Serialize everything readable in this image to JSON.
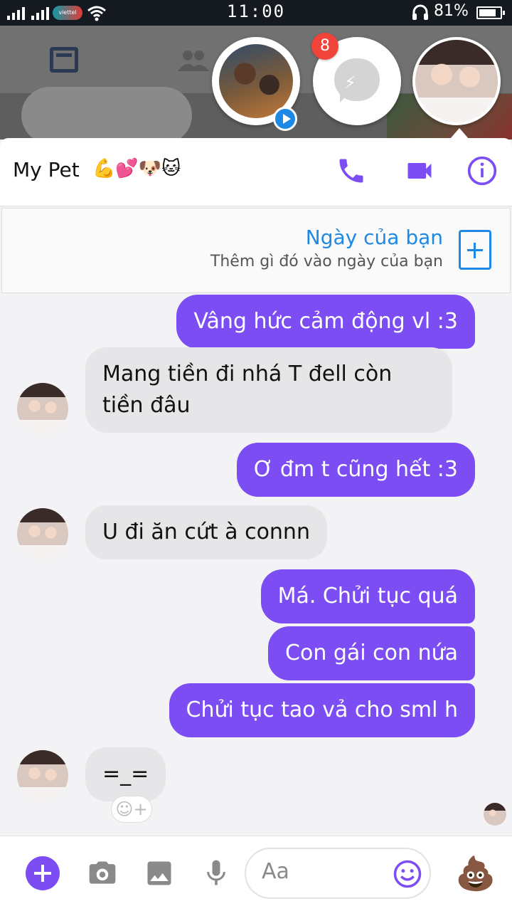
{
  "status_bar": {
    "carrier": "viettel",
    "time": "11:00",
    "battery": "81%",
    "battery_level": 0.81
  },
  "chat_heads": {
    "badge_count": "8"
  },
  "header": {
    "title": "My Pet",
    "title_emoji": "💪💕🐶🐱",
    "icons": [
      "phone-icon",
      "video-icon",
      "info-icon"
    ]
  },
  "day_card": {
    "title": "Ngày của bạn",
    "subtitle": "Thêm gì đó vào ngày của bạn"
  },
  "messages": [
    {
      "side": "out",
      "text": "Vâng hức cảm động vl :3"
    },
    {
      "side": "in",
      "text": "Mang tiền đi nhá T đell còn tiền đâu"
    },
    {
      "side": "out",
      "text": "Ơ đm t cũng hết :3"
    },
    {
      "side": "in",
      "text": "U đi ăn cứt à connn"
    },
    {
      "side": "out",
      "text": "Má. Chửi tục quá"
    },
    {
      "side": "out",
      "text": "Con gái con nứa"
    },
    {
      "side": "out",
      "text": "Chửi tục tao vả cho sml h"
    },
    {
      "side": "in",
      "text": "=_="
    }
  ],
  "composer": {
    "placeholder": "Aa",
    "send_emoji": "💩"
  },
  "colors": {
    "accent": "#7b4df3",
    "link": "#1e88e5",
    "badge": "#f0433a"
  }
}
